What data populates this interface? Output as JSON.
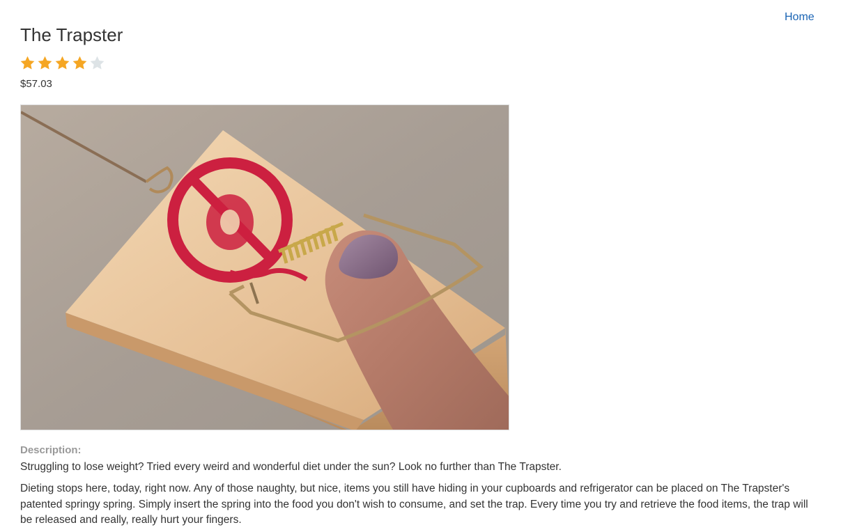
{
  "nav": {
    "home_label": "Home"
  },
  "product": {
    "title": "The Trapster",
    "rating": 4,
    "rating_max": 5,
    "price": "$57.03",
    "image_icon": "mousetrap-photo",
    "description_label": "Description:",
    "description_paragraphs": [
      "Struggling to lose weight? Tried every weird and wonderful diet under the sun? Look no further than The Trapster.",
      "Dieting stops here, today, right now. Any of those naughty, but nice, items you still have hiding in your cupboards and refrigerator can be placed on The Trapster's patented springy spring. Simply insert the spring into the food you don't wish to consume, and set the trap. Every time you try and retrieve the food items, the trap will be released and really, really hurt your fingers."
    ]
  },
  "colors": {
    "link": "#1a64b4",
    "star_filled": "#f5a623",
    "star_empty": "#dde3e6",
    "label_muted": "#999999",
    "text": "#333333"
  }
}
